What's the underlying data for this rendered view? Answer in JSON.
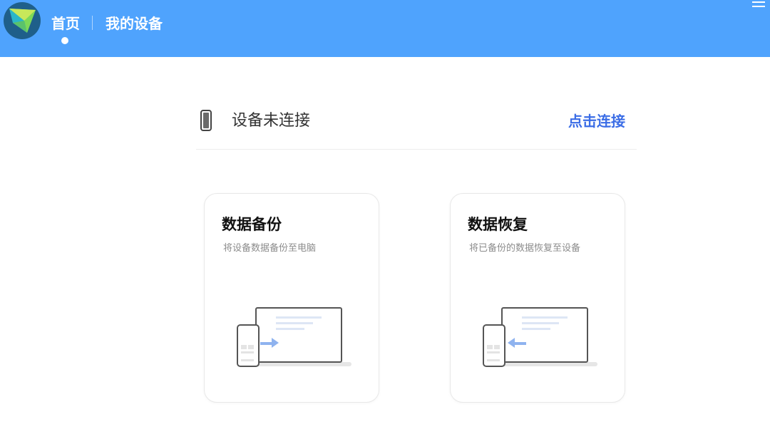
{
  "header": {
    "nav": {
      "home": "首页",
      "my_devices": "我的设备"
    },
    "colors": {
      "bar": "#4fa3fd"
    }
  },
  "status": {
    "text": "设备未连接",
    "action": "点击连接",
    "action_color": "#3b6de6"
  },
  "cards": {
    "backup": {
      "title": "数据备份",
      "desc": "将设备数据备份至电脑"
    },
    "restore": {
      "title": "数据恢复",
      "desc": "将已备份的数据恢复至设备"
    }
  },
  "icons": [
    "app-logo-icon",
    "menu-icon",
    "phone-icon",
    "backup-illustration-icon",
    "restore-illustration-icon"
  ]
}
